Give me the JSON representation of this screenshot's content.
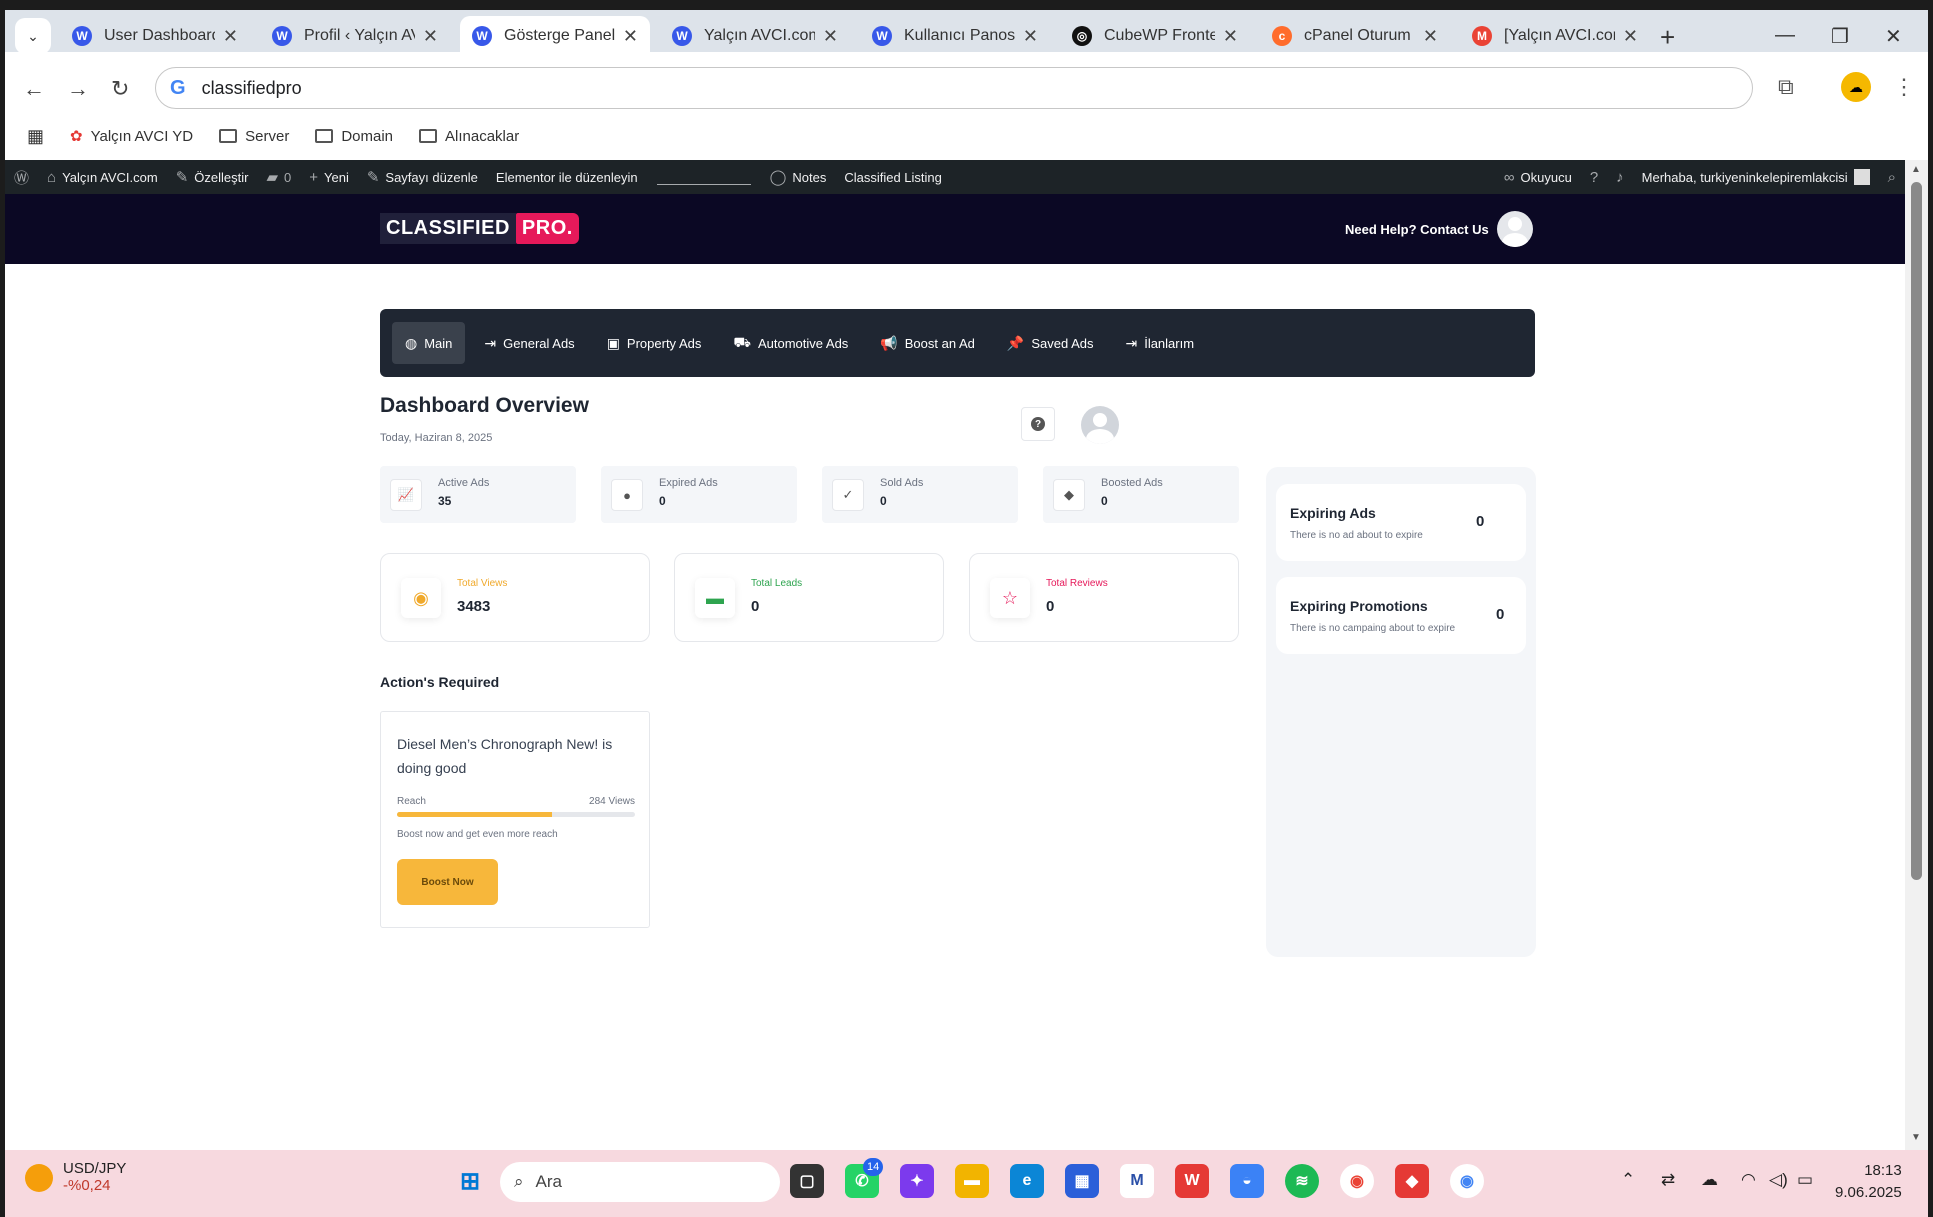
{
  "browser": {
    "tabs": [
      {
        "title": "User Dashboard",
        "favicon": "wordpress-icon",
        "color": "#3858e9"
      },
      {
        "title": "Profil ‹ Yalçın AVCI",
        "favicon": "wordpress-icon",
        "color": "#3858e9"
      },
      {
        "title": "Gösterge Paneli ‹",
        "favicon": "wordpress-icon",
        "color": "#3858e9",
        "active": true
      },
      {
        "title": "Yalçın AVCI.com",
        "favicon": "wordpress-icon",
        "color": "#3858e9"
      },
      {
        "title": "Kullanıcı Panosu",
        "favicon": "wordpress-icon",
        "color": "#3858e9"
      },
      {
        "title": "CubeWP Frontend",
        "favicon": "cubewp-icon",
        "color": "#111"
      },
      {
        "title": "cPanel Oturum",
        "favicon": "cpanel-icon",
        "color": "#ff6c2c"
      },
      {
        "title": "[Yalçın AVCI.com",
        "favicon": "gmail-icon",
        "color": "#ea4335"
      }
    ],
    "address": "classifiedpro",
    "bookmarks": [
      "Yalçın AVCI YD",
      "Server",
      "Domain",
      "Alınacaklar"
    ]
  },
  "wp_admin_bar": {
    "site": "Yalçın AVCI.com",
    "customize": "Özelleştir",
    "comments": "0",
    "new": "Yeni",
    "edit_page": "Sayfayı düzenle",
    "elementor": "Elementor ile düzenleyin",
    "notes": "Notes",
    "classified": "Classified Listing",
    "reader": "Okuyucu",
    "greeting": "Merhaba, turkiyeninkelepiremlakcisi"
  },
  "header": {
    "logo_main": "CLASSIFIED",
    "logo_accent": "PRO.",
    "help": "Need Help? Contact Us"
  },
  "dashboard": {
    "nav": [
      {
        "label": "Main",
        "icon": "globe-icon",
        "active": true
      },
      {
        "label": "General Ads",
        "icon": "sign-in-icon"
      },
      {
        "label": "Property Ads",
        "icon": "image-icon"
      },
      {
        "label": "Automotive Ads",
        "icon": "car-icon"
      },
      {
        "label": "Boost an Ad",
        "icon": "megaphone-icon"
      },
      {
        "label": "Saved Ads",
        "icon": "pin-icon"
      },
      {
        "label": "İlanlarım",
        "icon": "sign-in-icon"
      }
    ],
    "title": "Dashboard Overview",
    "date": "Today, Haziran 8, 2025",
    "stats": [
      {
        "label": "Active Ads",
        "value": "35",
        "icon": "chart-line-icon"
      },
      {
        "label": "Expired Ads",
        "value": "0",
        "icon": "alert-icon"
      },
      {
        "label": "Sold Ads",
        "value": "0",
        "icon": "check-icon"
      },
      {
        "label": "Boosted Ads",
        "value": "0",
        "icon": "diamond-icon"
      }
    ],
    "kpis": [
      {
        "label": "Total Views",
        "value": "3483",
        "icon": "eye-icon",
        "color": "#f0a92b"
      },
      {
        "label": "Total Leads",
        "value": "0",
        "icon": "chat-icon",
        "color": "#2ea44f"
      },
      {
        "label": "Total Reviews",
        "value": "0",
        "icon": "star-icon",
        "color": "#e6195a"
      }
    ],
    "actions_title": "Action's Required",
    "action_card": {
      "title": "Diesel Men’s Chronograph New! is doing good",
      "reach_label": "Reach",
      "views": "284 Views",
      "reach_fraction": 0.65,
      "hint": "Boost now and get even more reach",
      "button": "Boost Now"
    },
    "expiring": [
      {
        "title": "Expiring Ads",
        "subtitle": "There is no ad about to expire",
        "count": "0"
      },
      {
        "title": "Expiring Promotions",
        "subtitle": "There is no campaing about to expire",
        "count": "0"
      }
    ]
  },
  "taskbar": {
    "fx_pair": "USD/JPY",
    "fx_change": "-%0,24",
    "search": "Ara",
    "whatsapp_badge": "14",
    "time": "18:13",
    "date": "9.06.2025"
  }
}
